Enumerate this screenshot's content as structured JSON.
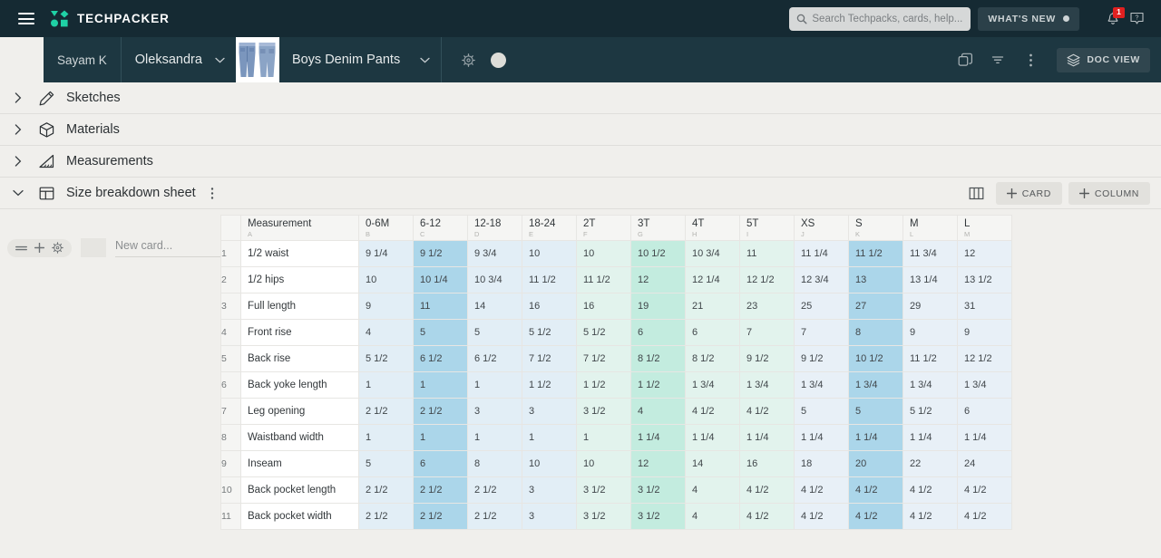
{
  "app": {
    "brand": "TECHPACKER",
    "hamburger_icon": "hamburger-menu-icon",
    "logo_icon": "techpacker-logo-icon",
    "accent_color": "#1fd1a5",
    "topbar_bg": "#152a33"
  },
  "topbar": {
    "search": {
      "placeholder": "Search Techpacks, cards, help...",
      "value": "",
      "icon": "search-icon"
    },
    "whats_new": {
      "label": "WHAT'S NEW",
      "dot": true
    },
    "notifications": {
      "icon": "bell-icon",
      "badge": "1",
      "badge_color": "#e02020"
    },
    "help": {
      "icon": "help-question-icon"
    }
  },
  "subbar": {
    "user": "Sayam K",
    "owner": "Oleksandra",
    "owner_chevron": "chevron-down-icon",
    "thumbnail": "denim-pants-thumbnail",
    "doc_title": "Boys Denim Pants",
    "doc_chevron": "chevron-down-icon",
    "settings_icon": "gear-icon",
    "avatar": "user-avatar",
    "tools": [
      {
        "name": "duplicate-icon"
      },
      {
        "name": "filter-icon"
      },
      {
        "name": "more-vertical-icon"
      }
    ],
    "doc_view": {
      "label": "DOC VIEW",
      "icon": "layers-icon"
    }
  },
  "sections": [
    {
      "label": "Sketches",
      "icon": "pencil-icon",
      "expanded": false,
      "caret": "chevron-right-icon"
    },
    {
      "label": "Materials",
      "icon": "cube-icon",
      "expanded": false,
      "caret": "chevron-right-icon"
    },
    {
      "label": "Measurements",
      "icon": "ruler-triangle-icon",
      "expanded": false,
      "caret": "chevron-right-icon"
    },
    {
      "label": "Size breakdown sheet",
      "icon": "table-layout-icon",
      "expanded": true,
      "caret": "chevron-down-icon",
      "menu": "more-vertical-icon"
    }
  ],
  "section_toolbar": {
    "columns_icon": "columns-view-icon",
    "add_card": {
      "label": "CARD",
      "icon": "plus-icon"
    },
    "add_column": {
      "label": "COLUMN",
      "icon": "plus-icon"
    }
  },
  "left_rail": {
    "drag_icon": "drag-handle-icon",
    "add_icon": "plus-icon",
    "settings_icon": "gear-icon",
    "new_card_placeholder": "New card..."
  },
  "sheet": {
    "columns": [
      {
        "name": "Measurement",
        "letter": "A",
        "kind": "label"
      },
      {
        "name": "0-6M",
        "letter": "B",
        "kind": "size",
        "tint": "#e2eef6"
      },
      {
        "name": "6-12",
        "letter": "C",
        "kind": "size",
        "tint": "#abd6ea"
      },
      {
        "name": "12-18",
        "letter": "D",
        "kind": "size",
        "tint": "#e2eef6"
      },
      {
        "name": "18-24",
        "letter": "E",
        "kind": "size",
        "tint": "#e2eef6"
      },
      {
        "name": "2T",
        "letter": "F",
        "kind": "size",
        "tint": "#e2f3ed"
      },
      {
        "name": "3T",
        "letter": "G",
        "kind": "size",
        "tint": "#c3ecdf"
      },
      {
        "name": "4T",
        "letter": "H",
        "kind": "size",
        "tint": "#e2f3ed"
      },
      {
        "name": "5T",
        "letter": "I",
        "kind": "size",
        "tint": "#e2f3ed"
      },
      {
        "name": "XS",
        "letter": "J",
        "kind": "size",
        "tint": "#e8f0f7"
      },
      {
        "name": "S",
        "letter": "K",
        "kind": "size",
        "tint": "#abd6ea"
      },
      {
        "name": "M",
        "letter": "L",
        "kind": "size",
        "tint": "#e8f0f7"
      },
      {
        "name": "L",
        "letter": "M",
        "kind": "size",
        "tint": "#e8f0f7"
      }
    ],
    "rows": [
      {
        "n": "1",
        "name": "1/2 waist",
        "values": [
          "9 1/4",
          "9 1/2",
          "9 3/4",
          "10",
          "10",
          "10 1/2",
          "10 3/4",
          "11",
          "11 1/4",
          "11 1/2",
          "11 3/4",
          "12"
        ]
      },
      {
        "n": "2",
        "name": "1/2 hips",
        "values": [
          "10",
          "10 1/4",
          "10 3/4",
          "11 1/2",
          "11 1/2",
          "12",
          "12 1/4",
          "12 1/2",
          "12 3/4",
          "13",
          "13 1/4",
          "13 1/2"
        ]
      },
      {
        "n": "3",
        "name": "Full length",
        "values": [
          "9",
          "11",
          "14",
          "16",
          "16",
          "19",
          "21",
          "23",
          "25",
          "27",
          "29",
          "31"
        ]
      },
      {
        "n": "4",
        "name": "Front rise",
        "values": [
          "4",
          "5",
          "5",
          "5 1/2",
          "5 1/2",
          "6",
          "6",
          "7",
          "7",
          "8",
          "9",
          "9"
        ]
      },
      {
        "n": "5",
        "name": "Back rise",
        "values": [
          "5 1/2",
          "6 1/2",
          "6 1/2",
          "7 1/2",
          "7 1/2",
          "8 1/2",
          "8 1/2",
          "9 1/2",
          "9 1/2",
          "10 1/2",
          "11 1/2",
          "12 1/2"
        ]
      },
      {
        "n": "6",
        "name": "Back yoke length",
        "values": [
          "1",
          "1",
          "1",
          "1 1/2",
          "1 1/2",
          "1 1/2",
          "1 3/4",
          "1 3/4",
          "1 3/4",
          "1 3/4",
          "1 3/4",
          "1 3/4"
        ]
      },
      {
        "n": "7",
        "name": "Leg opening",
        "values": [
          "2 1/2",
          "2 1/2",
          "3",
          "3",
          "3 1/2",
          "4",
          "4 1/2",
          "4 1/2",
          "5",
          "5",
          "5 1/2",
          "6"
        ]
      },
      {
        "n": "8",
        "name": "Waistband width",
        "values": [
          "1",
          "1",
          "1",
          "1",
          "1",
          "1 1/4",
          "1 1/4",
          "1 1/4",
          "1 1/4",
          "1 1/4",
          "1 1/4",
          "1 1/4"
        ]
      },
      {
        "n": "9",
        "name": "Inseam",
        "values": [
          "5",
          "6",
          "8",
          "10",
          "10",
          "12",
          "14",
          "16",
          "18",
          "20",
          "22",
          "24"
        ]
      },
      {
        "n": "10",
        "name": "Back pocket length",
        "values": [
          "2 1/2",
          "2 1/2",
          "2 1/2",
          "3",
          "3 1/2",
          "3 1/2",
          "4",
          "4 1/2",
          "4 1/2",
          "4 1/2",
          "4 1/2",
          "4 1/2"
        ]
      },
      {
        "n": "11",
        "name": "Back pocket width",
        "values": [
          "2 1/2",
          "2 1/2",
          "2 1/2",
          "3",
          "3 1/2",
          "3 1/2",
          "4",
          "4 1/2",
          "4 1/2",
          "4 1/2",
          "4 1/2",
          "4 1/2"
        ]
      }
    ]
  }
}
